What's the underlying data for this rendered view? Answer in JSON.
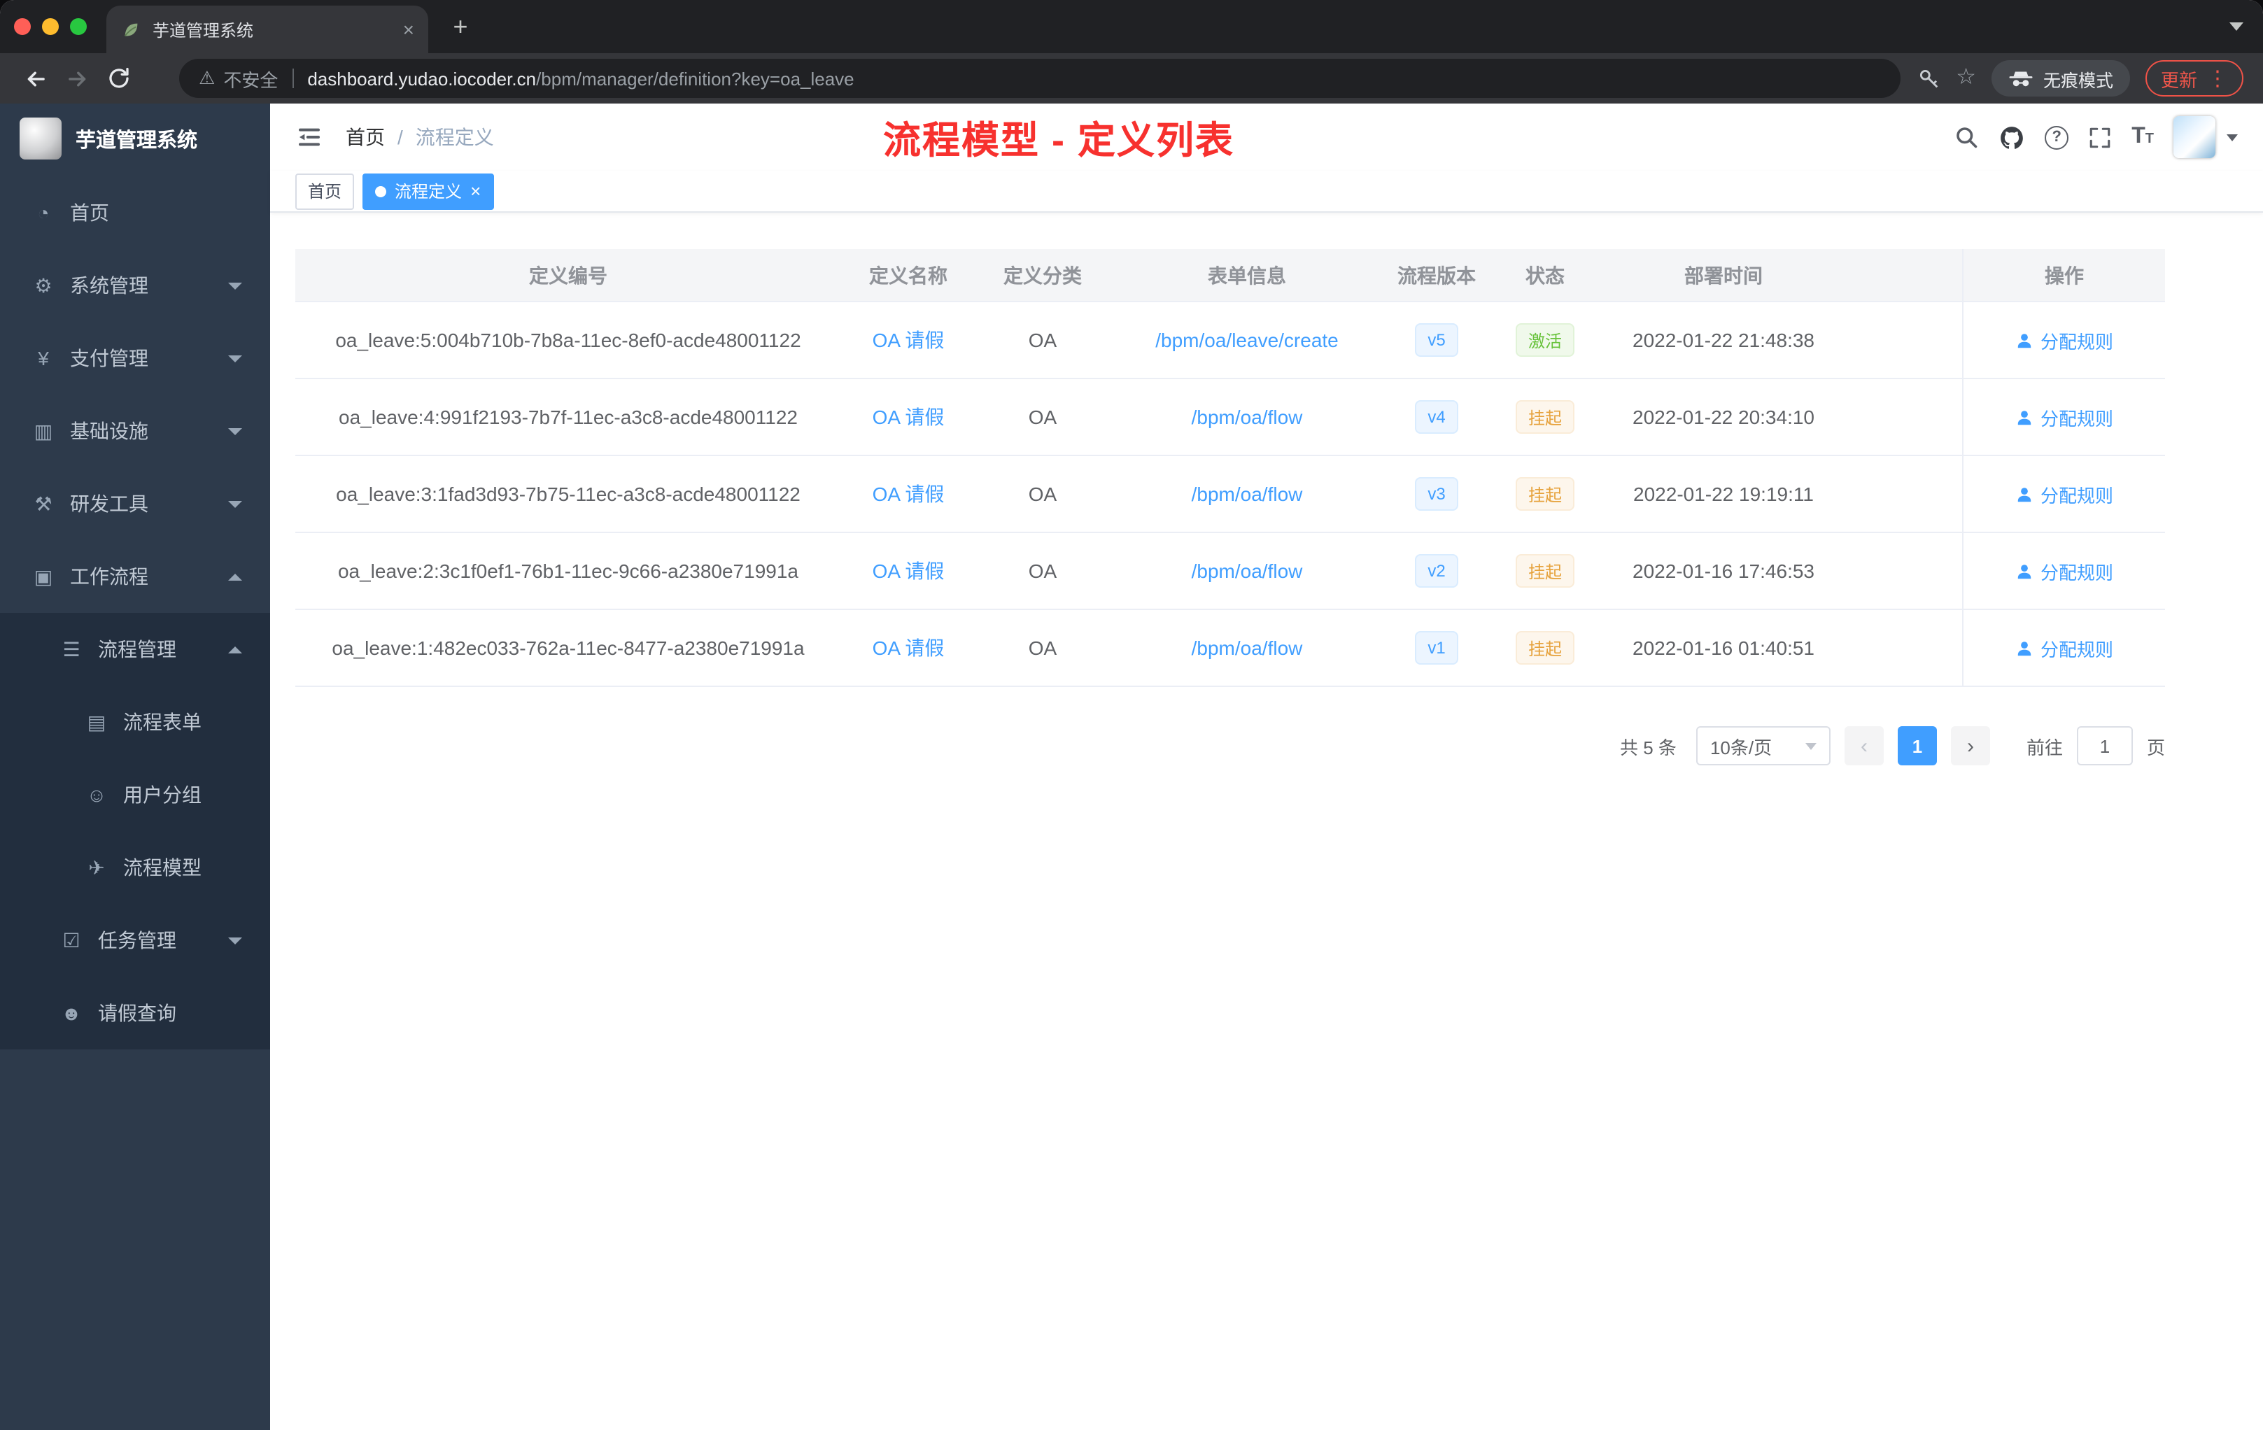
{
  "browser": {
    "tab": {
      "title": "芋道管理系统"
    },
    "address": {
      "security_label": "不安全",
      "domain": "dashboard.yudao.iocoder.cn",
      "path": "/bpm/manager/definition?key=oa_leave"
    },
    "incognito_label": "无痕模式",
    "update_label": "更新"
  },
  "sidebar": {
    "app_title": "芋道管理系统",
    "items": [
      {
        "label": "首页",
        "icon": "home-icon",
        "level": 1,
        "chevron": "",
        "submenu": false
      },
      {
        "label": "系统管理",
        "icon": "gear-icon",
        "level": 1,
        "chevron": "down",
        "submenu": false
      },
      {
        "label": "支付管理",
        "icon": "payment-icon",
        "level": 1,
        "chevron": "down",
        "submenu": false
      },
      {
        "label": "基础设施",
        "icon": "infrastructure-icon",
        "level": 1,
        "chevron": "down",
        "submenu": false
      },
      {
        "label": "研发工具",
        "icon": "devtools-icon",
        "level": 1,
        "chevron": "down",
        "submenu": false
      },
      {
        "label": "工作流程",
        "icon": "workflow-icon",
        "level": 1,
        "chevron": "up",
        "submenu": false
      },
      {
        "label": "流程管理",
        "icon": "process-icon",
        "level": 2,
        "chevron": "up",
        "submenu": true
      },
      {
        "label": "流程表单",
        "icon": "form-icon",
        "level": 3,
        "chevron": "",
        "submenu": true
      },
      {
        "label": "用户分组",
        "icon": "usergroup-icon",
        "level": 3,
        "chevron": "",
        "submenu": true
      },
      {
        "label": "流程模型",
        "icon": "model-icon",
        "level": 3,
        "chevron": "",
        "submenu": true
      },
      {
        "label": "任务管理",
        "icon": "task-icon",
        "level": 2,
        "chevron": "down",
        "submenu": true
      },
      {
        "label": "请假查询",
        "icon": "leave-icon",
        "level": 2,
        "chevron": "",
        "submenu": true
      }
    ]
  },
  "icons": {
    "home-icon": "◔",
    "gear-icon": "⚙",
    "payment-icon": "¥",
    "infrastructure-icon": "▥",
    "devtools-icon": "⚒",
    "workflow-icon": "▣",
    "process-icon": "☰",
    "form-icon": "▤",
    "usergroup-icon": "☺",
    "model-icon": "✈",
    "task-icon": "☑",
    "leave-icon": "☻"
  },
  "navbar": {
    "breadcrumb": {
      "root": "首页",
      "separator": "/",
      "current": "流程定义"
    },
    "annotation": "流程模型 - 定义列表"
  },
  "tags": [
    {
      "label": "首页"
    },
    {
      "label": "流程定义"
    }
  ],
  "table": {
    "columns": [
      "定义编号",
      "定义名称",
      "定义分类",
      "表单信息",
      "流程版本",
      "状态",
      "部署时间",
      "操作"
    ],
    "rows": [
      {
        "id": "oa_leave:5:004b710b-7b8a-11ec-8ef0-acde48001122",
        "name": "OA 请假",
        "category": "OA",
        "form": "/bpm/oa/leave/create",
        "version": "v5",
        "status": "激活",
        "status_type": "success",
        "deployed_at": "2022-01-22 21:48:38",
        "action": "分配规则"
      },
      {
        "id": "oa_leave:4:991f2193-7b7f-11ec-a3c8-acde48001122",
        "name": "OA 请假",
        "category": "OA",
        "form": "/bpm/oa/flow",
        "version": "v4",
        "status": "挂起",
        "status_type": "warning",
        "deployed_at": "2022-01-22 20:34:10",
        "action": "分配规则"
      },
      {
        "id": "oa_leave:3:1fad3d93-7b75-11ec-a3c8-acde48001122",
        "name": "OA 请假",
        "category": "OA",
        "form": "/bpm/oa/flow",
        "version": "v3",
        "status": "挂起",
        "status_type": "warning",
        "deployed_at": "2022-01-22 19:19:11",
        "action": "分配规则"
      },
      {
        "id": "oa_leave:2:3c1f0ef1-76b1-11ec-9c66-a2380e71991a",
        "name": "OA 请假",
        "category": "OA",
        "form": "/bpm/oa/flow",
        "version": "v2",
        "status": "挂起",
        "status_type": "warning",
        "deployed_at": "2022-01-16 17:46:53",
        "action": "分配规则"
      },
      {
        "id": "oa_leave:1:482ec033-762a-11ec-8477-a2380e71991a",
        "name": "OA 请假",
        "category": "OA",
        "form": "/bpm/oa/flow",
        "version": "v1",
        "status": "挂起",
        "status_type": "warning",
        "deployed_at": "2022-01-16 01:40:51",
        "action": "分配规则"
      }
    ]
  },
  "pagination": {
    "total_label": "共 5 条",
    "page_size": "10条/页",
    "current_page": "1",
    "goto_label": "前往",
    "goto_value": "1",
    "page_label": "页"
  },
  "colors": {
    "accent": "#409eff",
    "annotation_red": "#f7312e",
    "success": "#67c23a",
    "warning": "#e6a23c",
    "sidebar_bg": "#2d3a4b",
    "submenu_bg": "#222e3e"
  }
}
